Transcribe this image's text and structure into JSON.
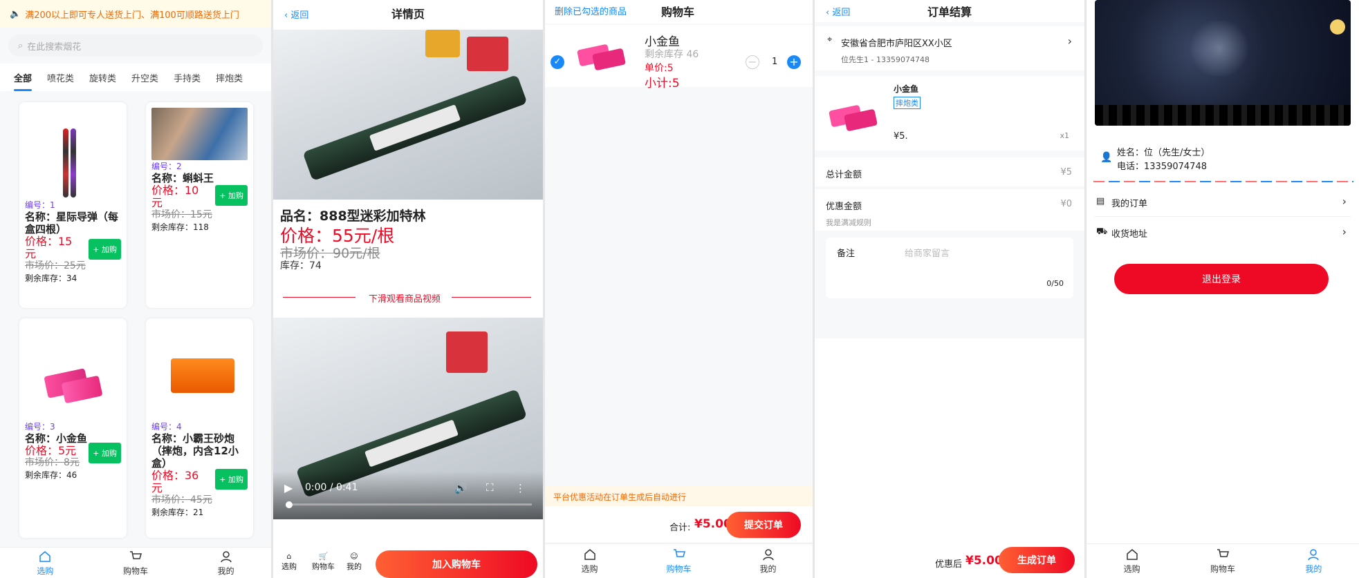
{
  "home": {
    "notice": "满200以上即可专人送货上门、满100可顺路送货上门",
    "search_placeholder": "在此搜索烟花",
    "categories": [
      "全部",
      "喷花类",
      "旋转类",
      "升空类",
      "手持类",
      "摔炮类"
    ],
    "products": [
      {
        "no": "编号：1",
        "name": "名称：星际导弹（每盒四根）",
        "price": "价格：15元",
        "market": "市场价：25元",
        "stock": "剩余库存：34"
      },
      {
        "no": "编号：2",
        "name": "名称：蝌蚪王",
        "price": "价格：10元",
        "market": "市场价：15元",
        "stock": "剩余库存：118"
      },
      {
        "no": "编号：3",
        "name": "名称：小金鱼",
        "price": "价格：5元",
        "market": "市场价：8元",
        "stock": "剩余库存：46"
      },
      {
        "no": "编号：4",
        "name": "名称：小霸王砂炮（摔炮，内含12小盒）",
        "price": "价格：36元",
        "market": "市场价：45元",
        "stock": "剩余库存：21"
      }
    ],
    "add_label": "+ 加购"
  },
  "tabs3": [
    "选购",
    "购物车",
    "我的"
  ],
  "detail": {
    "back": "返回",
    "title": "详情页",
    "name": "品名：888型迷彩加特林",
    "price": "价格：55元/根",
    "market": "市场价：90元/根",
    "stock": "库存：74",
    "video_hint": "下滑观看商品视频",
    "time": "0:00 / 0:41",
    "add_cart": "加入购物车"
  },
  "cart": {
    "delete": "删除已勾选的商品",
    "title": "购物车",
    "item_name": "小金鱼",
    "item_stock": "剩余库存 46",
    "item_unit": "单价:5",
    "item_subtotal": "小计:5",
    "qty": "1",
    "promo": "平台优惠活动在订单生成后自动进行",
    "total_label": "合计:",
    "total": "¥5.00",
    "submit": "提交订单"
  },
  "checkout": {
    "back": "返回",
    "title": "订单结算",
    "address": "安徽省合肥市庐阳区XX小区",
    "contact": "位先生1 - 13359074748",
    "item_name": "小金鱼",
    "item_tag": "摔炮类",
    "item_price": "¥5.",
    "item_qty": "x1",
    "total_label": "总计金额",
    "total_value": "¥5",
    "discount_label": "优惠金额",
    "discount_value": "¥0",
    "discount_note": "我是满减规则",
    "remark_label": "备注",
    "remark_placeholder": "给商家留言",
    "remark_count": "0/50",
    "after_label": "优惠后",
    "after_value": "¥5.00",
    "generate": "生成订单"
  },
  "mine": {
    "name": "姓名：位（先生/女士）",
    "phone": "电话：13359074748",
    "orders": "我的订单",
    "address": "收货地址",
    "logout": "退出登录"
  },
  "colors": {
    "accent": "#1989fa",
    "red": "#ee0a24",
    "green": "#07c160"
  }
}
